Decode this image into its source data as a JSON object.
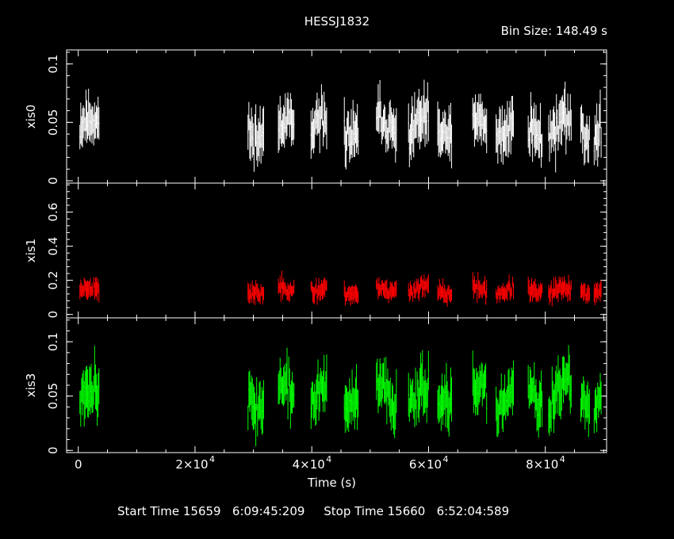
{
  "title": "HESSJ1832",
  "bin_size": "Bin Size: 148.49 s",
  "footer": "Start Time 15659   6:09:45:209     Stop Time 15660   6:52:04:589",
  "chart_data": {
    "type": "scatter",
    "title": "HESSJ1832",
    "xlabel": "Time (s)",
    "xlim": [
      -2000,
      90500
    ],
    "x_ticks": [
      {
        "value": 0,
        "label": "0"
      },
      {
        "value": 20000,
        "label": "2×10",
        "exp": "4"
      },
      {
        "value": 40000,
        "label": "4×10",
        "exp": "4"
      },
      {
        "value": 60000,
        "label": "6×10",
        "exp": "4"
      },
      {
        "value": 80000,
        "label": "8×10",
        "exp": "4"
      }
    ],
    "segments": [
      [
        200,
        3500
      ],
      [
        29000,
        31800
      ],
      [
        34200,
        37000
      ],
      [
        39800,
        42500
      ],
      [
        45500,
        48000
      ],
      [
        51000,
        54500
      ],
      [
        56500,
        60000
      ],
      [
        61500,
        64000
      ],
      [
        67500,
        70000
      ],
      [
        71500,
        74500
      ],
      [
        77000,
        79500
      ],
      [
        80500,
        84500
      ],
      [
        86000,
        87500
      ],
      [
        88300,
        89600
      ]
    ],
    "panels": [
      {
        "name": "xis0",
        "ylabel": "xis0",
        "color": "#ffffff",
        "ylim": [
          -0.002,
          0.112
        ],
        "yticks": [
          0,
          0.05,
          0.1
        ],
        "yticklabels": [
          "0",
          "0.05",
          "0.1"
        ],
        "mean": 0.045,
        "spread": 0.014,
        "err": 0.016,
        "seed": 11
      },
      {
        "name": "xis1",
        "ylabel": "xis1",
        "color": "#ff0000",
        "ylim": [
          -0.02,
          0.77
        ],
        "yticks": [
          0,
          0.2,
          0.4,
          0.6
        ],
        "yticklabels": [
          "0",
          "0.2",
          "0.4",
          "0.6"
        ],
        "mean": 0.14,
        "spread": 0.035,
        "err": 0.045,
        "seed": 23
      },
      {
        "name": "xis3",
        "ylabel": "xis3",
        "color": "#00ff00",
        "ylim": [
          -0.002,
          0.122
        ],
        "yticks": [
          0,
          0.05,
          0.1
        ],
        "yticklabels": [
          "0",
          "0.05",
          "0.1"
        ],
        "mean": 0.05,
        "spread": 0.016,
        "err": 0.017,
        "seed": 37
      }
    ]
  }
}
